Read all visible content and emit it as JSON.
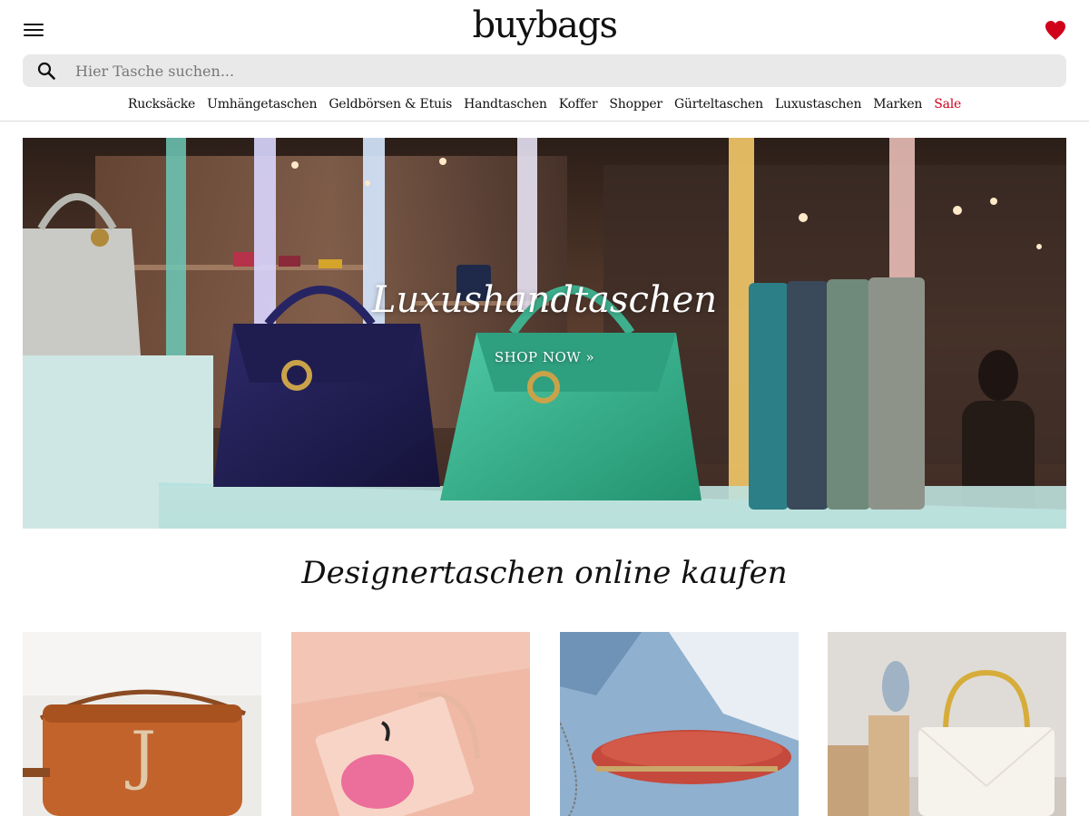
{
  "header": {
    "logo": "buybags",
    "menu_icon": "hamburger-menu-icon",
    "wishlist_icon": "heart-icon",
    "accent_color": "#d0021b"
  },
  "search": {
    "placeholder": "Hier Tasche suchen...",
    "value": "",
    "icon": "search-icon"
  },
  "nav": {
    "items": [
      {
        "label": "Rucksäcke"
      },
      {
        "label": "Umhängetaschen"
      },
      {
        "label": "Geldbörsen & Etuis"
      },
      {
        "label": "Handtaschen"
      },
      {
        "label": "Koffer"
      },
      {
        "label": "Shopper"
      },
      {
        "label": "Gürteltaschen"
      },
      {
        "label": "Luxustaschen"
      },
      {
        "label": "Marken"
      },
      {
        "label": "Sale"
      }
    ]
  },
  "hero": {
    "title": "Luxushandtaschen",
    "cta": "SHOP NOW »"
  },
  "section": {
    "title": "Designertaschen online kaufen"
  },
  "cards": [
    {
      "image": "brown-leather-camera-bag"
    },
    {
      "image": "pink-clutch-flamingo"
    },
    {
      "image": "red-minaudiere-clutch"
    },
    {
      "image": "white-quilted-handbag"
    }
  ]
}
